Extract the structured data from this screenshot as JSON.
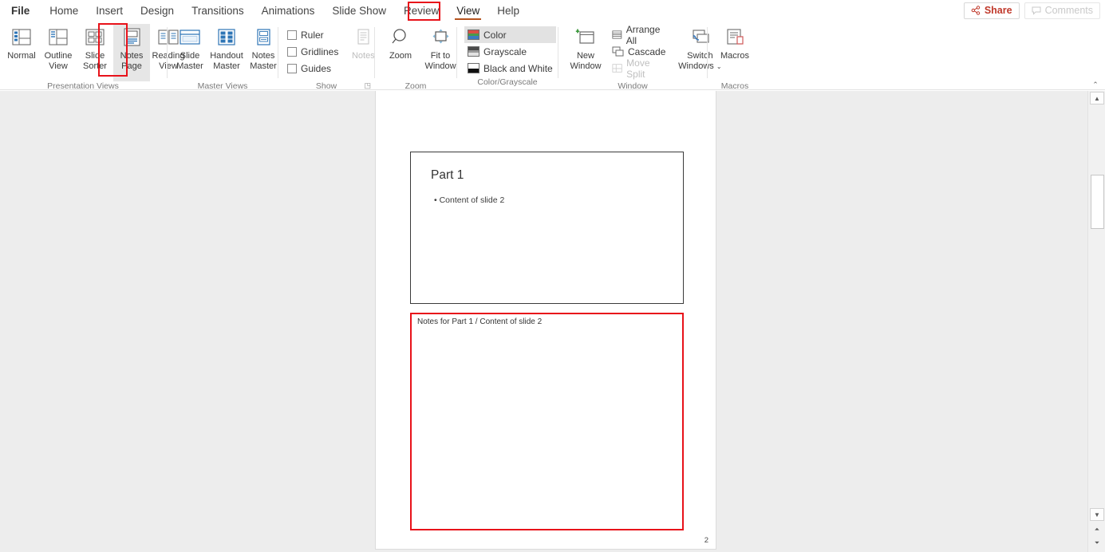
{
  "window": {
    "tabs": [
      {
        "id": "file",
        "label": "File"
      },
      {
        "id": "home",
        "label": "Home"
      },
      {
        "id": "insert",
        "label": "Insert"
      },
      {
        "id": "design",
        "label": "Design"
      },
      {
        "id": "transitions",
        "label": "Transitions"
      },
      {
        "id": "animations",
        "label": "Animations"
      },
      {
        "id": "slideshow",
        "label": "Slide Show"
      },
      {
        "id": "review",
        "label": "Review"
      },
      {
        "id": "view",
        "label": "View"
      },
      {
        "id": "help",
        "label": "Help"
      }
    ],
    "active_tab": "View",
    "share_label": "Share",
    "share_icon": "share-icon",
    "comments_label": "Comments",
    "comments_icon": "comment-bubble-icon",
    "collapse_ribbon_icon": "chevron-up-icon",
    "annotation_color": "#e8121a",
    "active_tab_underline_color": "#b5531f",
    "share_text_color": "#c0392b"
  },
  "ribbon": {
    "groups": [
      {
        "id": "presentation-views",
        "label": "Presentation Views",
        "buttons": [
          {
            "id": "normal",
            "label": "Normal",
            "icon": "normal-view-icon",
            "state": "default"
          },
          {
            "id": "outline-view",
            "label": "Outline View",
            "icon": "outline-view-icon",
            "state": "default"
          },
          {
            "id": "slide-sorter",
            "label": "Slide Sorter",
            "icon": "slide-sorter-icon",
            "state": "default"
          },
          {
            "id": "notes-page",
            "label": "Notes Page",
            "icon": "notes-page-icon",
            "state": "selected"
          },
          {
            "id": "reading-view",
            "label": "Reading View",
            "icon": "reading-view-icon",
            "state": "default"
          }
        ]
      },
      {
        "id": "master-views",
        "label": "Master Views",
        "buttons": [
          {
            "id": "slide-master",
            "label": "Slide Master",
            "icon": "slide-master-icon",
            "state": "default"
          },
          {
            "id": "handout-master",
            "label": "Handout Master",
            "icon": "handout-master-icon",
            "state": "default"
          },
          {
            "id": "notes-master",
            "label": "Notes Master",
            "icon": "notes-master-icon",
            "state": "default"
          }
        ]
      },
      {
        "id": "show",
        "label": "Show",
        "has_dialog_launcher": true,
        "checkboxes": [
          {
            "id": "ruler",
            "label": "Ruler",
            "checked": false
          },
          {
            "id": "gridlines",
            "label": "Gridlines",
            "checked": false
          },
          {
            "id": "guides",
            "label": "Guides",
            "checked": false
          }
        ],
        "buttons": [
          {
            "id": "notes",
            "label": "Notes",
            "icon": "notes-pane-icon",
            "state": "disabled"
          }
        ]
      },
      {
        "id": "zoom",
        "label": "Zoom",
        "buttons": [
          {
            "id": "zoom",
            "label": "Zoom",
            "icon": "magnifier-icon",
            "state": "default"
          },
          {
            "id": "fit-to-window",
            "label": "Fit to Window",
            "icon": "fit-to-window-icon",
            "state": "default"
          }
        ]
      },
      {
        "id": "color-grayscale",
        "label": "Color/Grayscale",
        "items": [
          {
            "id": "color",
            "label": "Color",
            "icon": "color-swatch-icon",
            "state": "selected"
          },
          {
            "id": "grayscale",
            "label": "Grayscale",
            "icon": "grayscale-swatch-icon",
            "state": "default"
          },
          {
            "id": "black-and-white",
            "label": "Black and White",
            "icon": "blackwhite-swatch-icon",
            "state": "default"
          }
        ]
      },
      {
        "id": "window",
        "label": "Window",
        "buttons": [
          {
            "id": "new-window",
            "label": "New Window",
            "icon": "new-window-icon",
            "state": "default"
          },
          {
            "id": "switch-windows",
            "label": "Switch Windows",
            "icon": "switch-windows-icon",
            "state": "default",
            "has_dropdown": true
          }
        ],
        "items": [
          {
            "id": "arrange-all",
            "label": "Arrange All",
            "icon": "arrange-all-icon",
            "state": "default"
          },
          {
            "id": "cascade",
            "label": "Cascade",
            "icon": "cascade-icon",
            "state": "default"
          },
          {
            "id": "move-split",
            "label": "Move Split",
            "icon": "move-split-icon",
            "state": "disabled"
          }
        ]
      },
      {
        "id": "macros",
        "label": "Macros",
        "buttons": [
          {
            "id": "macros",
            "label": "Macros",
            "icon": "macros-icon",
            "state": "default"
          }
        ]
      }
    ]
  },
  "notes_page": {
    "slide": {
      "title": "Part 1",
      "bullet": "• Content of slide 2"
    },
    "notes_text": "Notes for Part 1 / Content of slide 2",
    "page_number": "2",
    "notes_highlight_color": "#e8121a"
  },
  "scrollbar": {
    "scroll_up_icon": "triangle-up-icon",
    "scroll_down_icon": "triangle-down-icon",
    "previous_slide_icon": "double-up-icon",
    "next_slide_icon": "double-down-icon"
  }
}
